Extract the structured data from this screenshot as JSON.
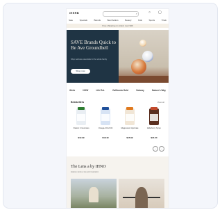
{
  "header": {
    "logo": "iHERB",
    "nav": [
      "Sale",
      "Specials",
      "Brands",
      "Best Sellers",
      "Beauty",
      "Kids",
      "Sports",
      "Trials"
    ],
    "promo": "Free shipping on orders over $40"
  },
  "hero": {
    "title": "SAVE Brands Quick to Be Ave Groundbell",
    "subtitle": "Shop wellness essentials for the whole family",
    "cta": "Shop now"
  },
  "brands": [
    "iHerb",
    "NOW",
    "Life Ext.",
    "California Gold",
    "Solaray",
    "Nature's Way"
  ],
  "products_section": {
    "title": "Bestsellers",
    "view_all": "View all",
    "items": [
      {
        "name": "Vitamin C Gummies",
        "price": "$12.99",
        "color": "#e9eef3",
        "cap": "#2e7d32"
      },
      {
        "name": "Omega-3 Fish Oil",
        "price": "$18.49",
        "color": "#d7e3f4",
        "cap": "#1f4f9a"
      },
      {
        "name": "Magnesium Glycinate",
        "price": "$15.99",
        "color": "#f1e6d6",
        "cap": "#e07a1f"
      },
      {
        "name": "Elderberry Syrup",
        "price": "$21.00",
        "color": "#5a2f20",
        "cap": "#c24a2c"
      }
    ]
  },
  "story": {
    "title": "The Lens a by IHNO",
    "subtitle": "Explore stories, tips and inspiration"
  },
  "icons": {
    "search": "search-icon",
    "account": "account-icon",
    "cart": "cart-icon",
    "prev": "chevron-left-icon",
    "next": "chevron-right-icon"
  }
}
